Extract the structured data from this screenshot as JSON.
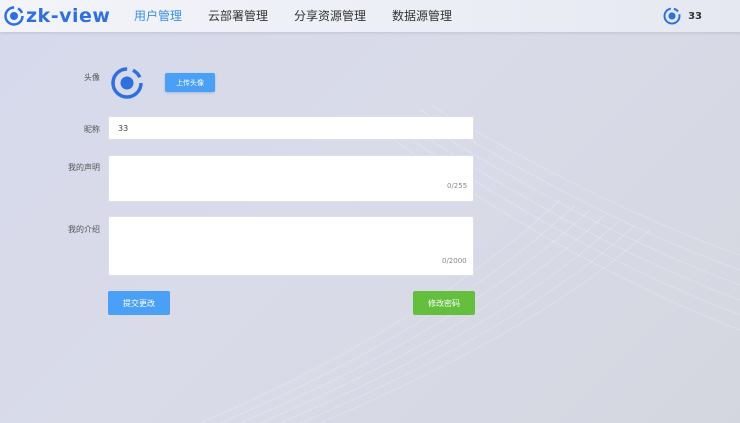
{
  "header": {
    "logo_text": "zk-view",
    "nav": [
      "用户管理",
      "云部署管理",
      "分享资源管理",
      "数据源管理"
    ],
    "active_index": 0,
    "username": "33"
  },
  "form": {
    "avatar_label": "头像",
    "upload_button": "上传头像",
    "nickname_label": "昵称",
    "nickname_value": "33",
    "statement_label": "我的声明",
    "statement_value": "",
    "statement_counter": "0/255",
    "intro_label": "我的介绍",
    "intro_value": "",
    "intro_counter": "0/2000",
    "submit_button": "提交更改",
    "password_button": "修改密码"
  },
  "colors": {
    "accent": "#3a8ee6",
    "logo": "#2f6fe0",
    "primary_button": "#4aa0f4",
    "success_button": "#63bf3d"
  },
  "icons": {
    "logo": "ring-logo-icon",
    "avatar": "ring-avatar-icon"
  }
}
